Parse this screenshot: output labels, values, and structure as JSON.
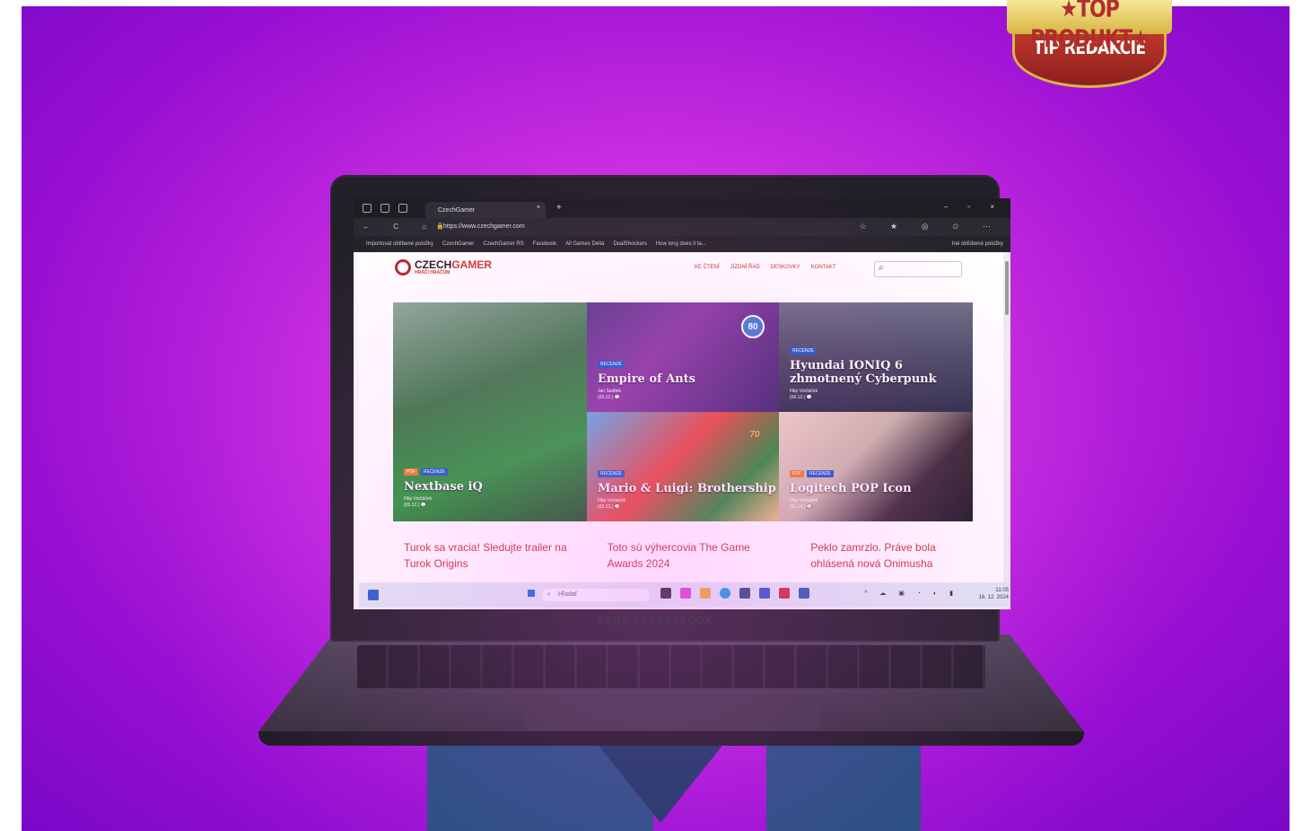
{
  "award": {
    "top_text": "★TOP PRODUKT★",
    "bottom_text": "TIP REDAKCIE"
  },
  "laptop": {
    "brand": "ASUS EXPERTBOOK"
  },
  "browser": {
    "tab_title": "CzechGamer",
    "tab_close": "×",
    "new_tab": "+",
    "window_controls": "– ▫ ×",
    "nav_icons": "← C ⌂",
    "url": "https://www.czechgamer.com",
    "addr_right_icons": "☆ ★ ◎ ✩ ⋯",
    "bookmarks": [
      "Importovat oblíbené položky",
      "CzechGamer",
      "CzechGamer RS",
      "Facebook",
      "All Games Delta",
      "DualShockers",
      "How long does it ta..."
    ],
    "bookmarks_right": "Iné obľúbené položky"
  },
  "site": {
    "logo_top": "CZECH",
    "logo_top_accent": "GAMER",
    "logo_sub": "HRÁČI HRÁČŮM",
    "nav": [
      "KE ČTENÍ",
      "JÍZDNÍ ŘÁD",
      "DESKOVKY",
      "KONTAKT"
    ],
    "search_icon": "⌕",
    "cards": [
      {
        "tags": [
          "PDF",
          "RECENZE"
        ],
        "title": "Nextbase iQ",
        "author": "Filip Vorčáček",
        "date": "(05.12.) 💬"
      },
      {
        "tags": [
          "RECENZE"
        ],
        "title": "Empire of Ants",
        "author": "Jan Sadilek",
        "date": "(03.12.) 💬",
        "score": "80"
      },
      {
        "tags": [
          "RECENZE"
        ],
        "title": "Hyundai IONIQ 6 zhmotnený Cyberpunk",
        "author": "Filip Vorčáček",
        "date": "(06.12.) 💬"
      },
      {
        "tags": [
          "RECENZE"
        ],
        "title": "Mario & Luigi: Brothership",
        "author": "Filip Vorčáček",
        "date": "(02.12.) 💬",
        "score": "70"
      },
      {
        "tags": [
          "PDF",
          "RECENZE"
        ],
        "title": "Logitech POP Icon",
        "author": "Filip Vorčáček",
        "date": "(01.12.) 💬"
      }
    ],
    "headlines": [
      "Turok sa vracia! Sledujte trailer na Turok Origins",
      "Toto sú výhercovia The Game Awards 2024",
      "Peklo zamrzlo. Práve bola ohlásená nová Onimusha"
    ]
  },
  "taskbar": {
    "search_placeholder": "Hľadať",
    "search_icon": "⌕",
    "tray_icons": "^ ☁ ▣ ◔ ◐ ▮",
    "time": "11:05",
    "date": "16. 12. 2024"
  }
}
